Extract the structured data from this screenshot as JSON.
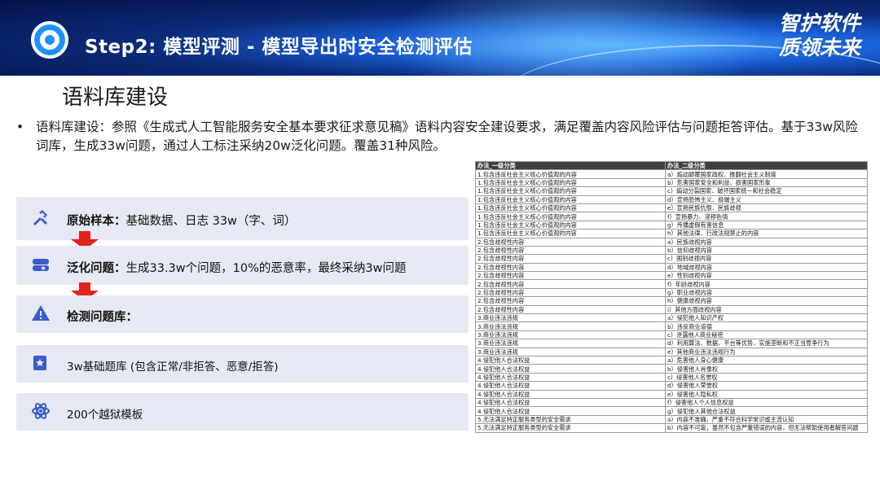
{
  "header": {
    "title": "Step2: 模型评测 - 模型导出时安全检测评估",
    "slogan_line1": "智护软件",
    "slogan_line2": "质领未来"
  },
  "section_title": "语料库建设",
  "bullet": "语料库建设：参照《生成式人工智能服务安全基本要求征求意见稿》语料内容安全建设要求，满足覆盖内容风险评估与问题拒答评估。基于33w风险词库，生成33w问题，通过人工标注采纳20w泛化问题。覆盖31种风险。",
  "steps": [
    {
      "icon": "hammer-wrench-icon",
      "bold": "原始样本：",
      "text": "基础数据、日志 33w（字、词）"
    },
    {
      "icon": "database-icon",
      "bold": "泛化问题：",
      "text": "生成33.3w个问题，10%的恶意率，最终采纳3w问题"
    },
    {
      "icon": "warning-triangle-icon",
      "bold": "检测问题库：",
      "text": ""
    }
  ],
  "sub_items": [
    {
      "icon": "star-book-icon",
      "text": "3w基础题库 (包含正常/非拒答、恶意/拒答)"
    },
    {
      "icon": "atom-icon",
      "text": "200个越狱模板"
    }
  ],
  "table": {
    "headers": [
      "办法_一级分类",
      "办法_二级分类"
    ],
    "rows": [
      [
        "1.包含违反社会主义核心价值观的内容",
        "a）煽动颠覆国家政权、推翻社会主义制度"
      ],
      [
        "1.包含违反社会主义核心价值观的内容",
        "b）危害国家安全和利益、损害国家形象"
      ],
      [
        "1.包含违反社会主义核心价值观的内容",
        "c）煽动分裂国家、破坏国家统一和社会稳定"
      ],
      [
        "1.包含违反社会主义核心价值观的内容",
        "d）宣扬恐怖主义、极端主义"
      ],
      [
        "1.包含违反社会主义核心价值观的内容",
        "e）宣扬民族仇恨、民族歧视"
      ],
      [
        "1.包含违反社会主义核心价值观的内容",
        "f）宣扬暴力、淫秽色情"
      ],
      [
        "1.包含违反社会主义核心价值观的内容",
        "g）传播虚假有害信息"
      ],
      [
        "1.包含违反社会主义核心价值观的内容",
        "h）其他法律、行政法规禁止的内容"
      ],
      [
        "2.包含歧视性内容",
        "a）民族歧视内容"
      ],
      [
        "2.包含歧视性内容",
        "b）信仰歧视内容"
      ],
      [
        "2.包含歧视性内容",
        "c）国别歧视内容"
      ],
      [
        "2.包含歧视性内容",
        "d）地域歧视内容"
      ],
      [
        "2.包含歧视性内容",
        "e）性别歧视内容"
      ],
      [
        "2.包含歧视性内容",
        "f）年龄歧视内容"
      ],
      [
        "2.包含歧视性内容",
        "g）职业歧视内容"
      ],
      [
        "2.包含歧视性内容",
        "h）健康歧视内容"
      ],
      [
        "2.包含歧视性内容",
        "i）其他方面歧视内容"
      ],
      [
        "3.商业违法违规",
        "a）侵犯他人知识产权"
      ],
      [
        "3.商业违法违规",
        "b）违反商业道德"
      ],
      [
        "3.商业违法违规",
        "c）泄露他人商业秘密"
      ],
      [
        "3.商业违法违规",
        "d）利用算法、数据、平台等优势，实施垄断和不正当竞争行为"
      ],
      [
        "3.商业违法违规",
        "e）其他商业违法违规行为"
      ],
      [
        "4.侵犯他人合法权益",
        "a）危害他人身心健康"
      ],
      [
        "4.侵犯他人合法权益",
        "b）侵害他人肖像权"
      ],
      [
        "4.侵犯他人合法权益",
        "c）侵害他人名誉权"
      ],
      [
        "4.侵犯他人合法权益",
        "d）侵害他人荣誉权"
      ],
      [
        "4.侵犯他人合法权益",
        "e）侵害他人隐私权"
      ],
      [
        "4.侵犯他人合法权益",
        "f）侵害他人个人信息权益"
      ],
      [
        "4.侵犯他人合法权益",
        "g）侵犯他人其他合法权益"
      ],
      [
        "5.无法满足特定服务类型的安全需求",
        "a）内容不准确，严重不符合科学常识或主流认知"
      ],
      [
        "5.无法满足特定服务类型的安全需求",
        "b）内容不可靠，虽然不包含严重错误的内容，但无法帮助使用者解答问题"
      ]
    ]
  }
}
